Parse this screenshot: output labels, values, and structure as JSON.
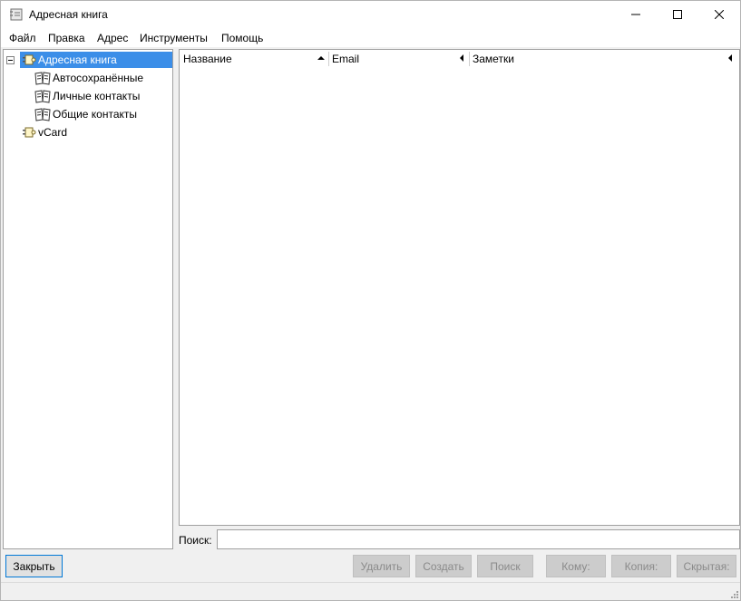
{
  "window": {
    "title": "Адресная книга"
  },
  "menu": {
    "items": [
      "Файл",
      "Правка",
      "Адрес",
      "Инструменты",
      "Помощь"
    ]
  },
  "tree": {
    "root": {
      "label": "Адресная книга",
      "icon": "address-book-icon",
      "expanded": true,
      "selected": true
    },
    "children": [
      {
        "label": "Автосохранённые",
        "icon": "open-book-icon"
      },
      {
        "label": "Личные контакты",
        "icon": "open-book-icon"
      },
      {
        "label": "Общие контакты",
        "icon": "open-book-icon"
      }
    ],
    "second_root": {
      "label": "vCard",
      "icon": "address-book-icon"
    }
  },
  "list": {
    "columns": [
      {
        "label": "Название",
        "sort": "ascending"
      },
      {
        "label": "Email",
        "sort": "none"
      },
      {
        "label": "Заметки",
        "sort": "none"
      }
    ],
    "rows": []
  },
  "search": {
    "label": "Поиск:",
    "value": ""
  },
  "buttons": {
    "close": "Закрыть",
    "delete": "Удалить",
    "create": "Создать",
    "find": "Поиск",
    "to": "Кому:",
    "cc": "Копия:",
    "bcc": "Скрытая:"
  },
  "colors": {
    "selection": "#3b8ee8",
    "default_button_border": "#0078d7"
  }
}
